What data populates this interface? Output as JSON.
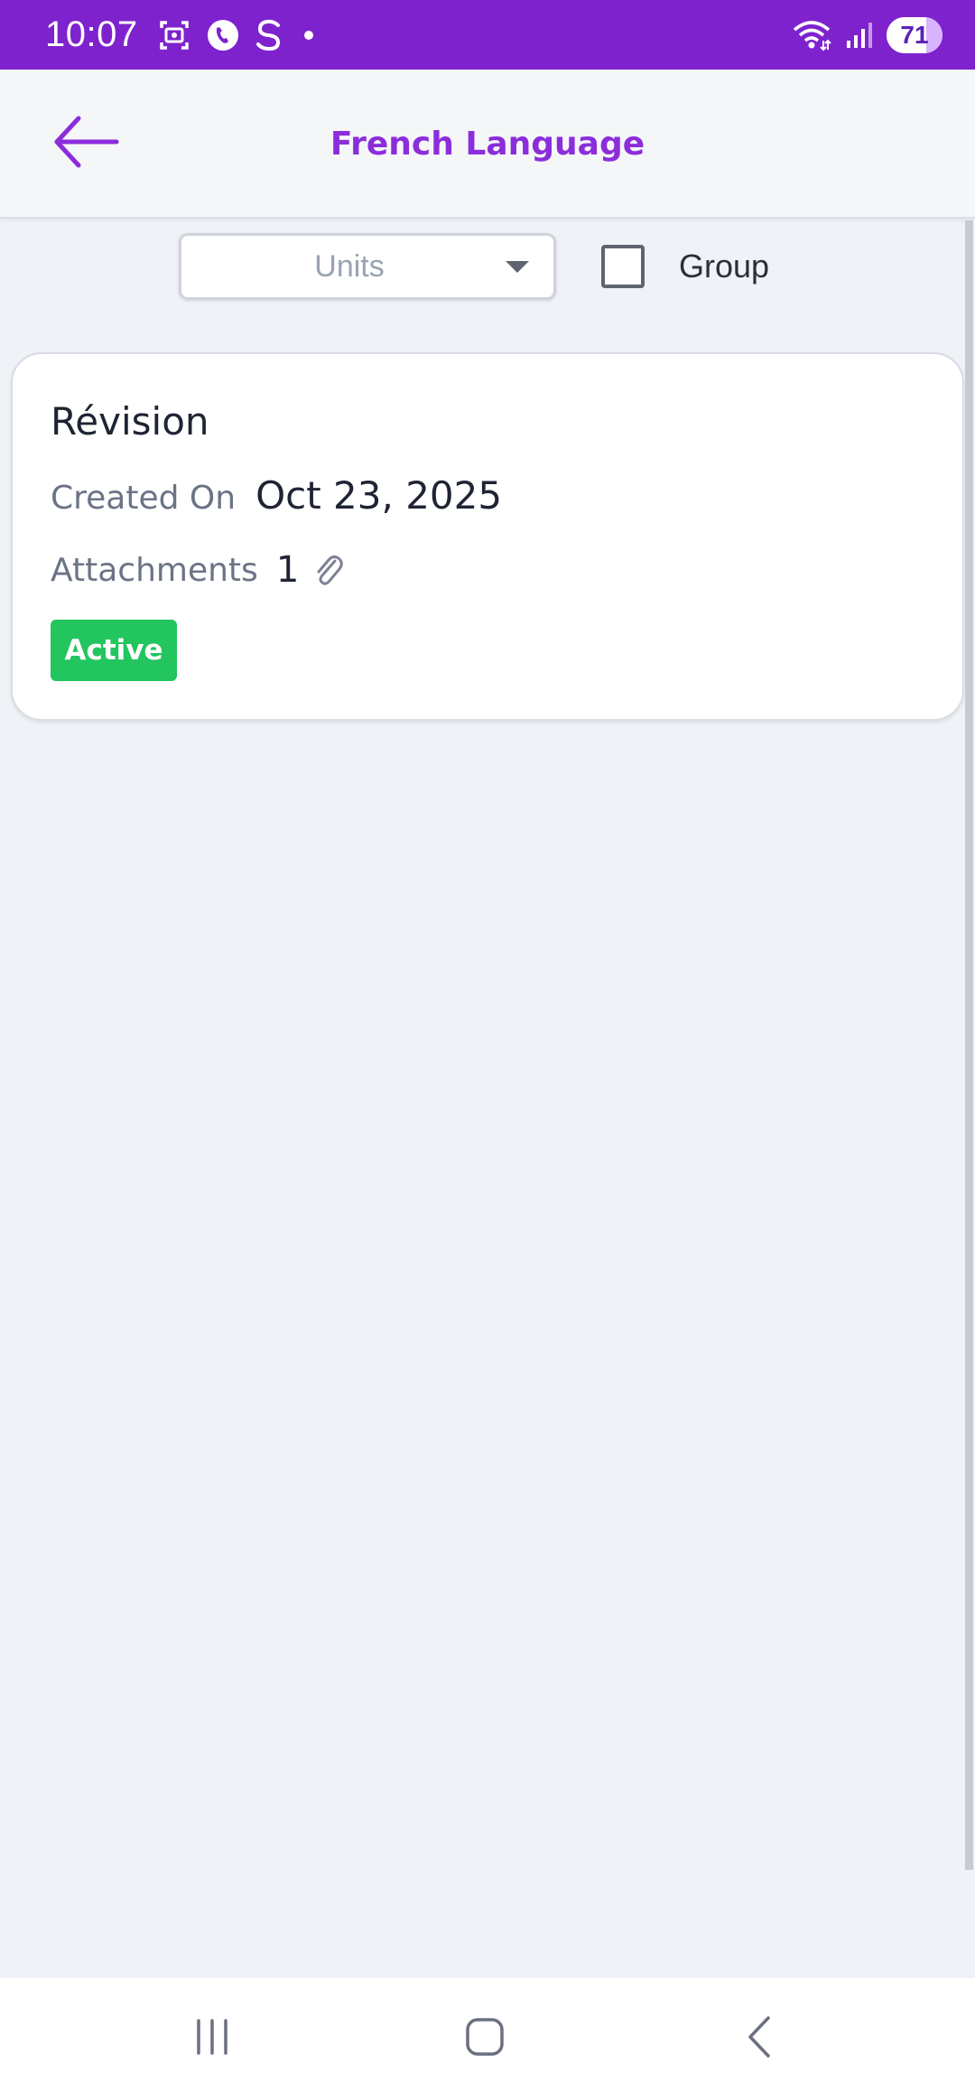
{
  "status_bar": {
    "time": "10:07",
    "battery_level": "71",
    "icons": [
      "screenshot-icon",
      "phone-call-icon",
      "s-app-icon",
      "notification-dot-icon",
      "wifi-icon",
      "signal-icon",
      "battery-icon"
    ]
  },
  "header": {
    "title": "French Language",
    "back_icon": "arrow-left-icon",
    "accent_color": "#8b2ddb",
    "status_bar_color": "#7e22ce"
  },
  "filters": {
    "units_placeholder": "Units",
    "group_label": "Group",
    "group_checked": false
  },
  "card": {
    "title": "Révision",
    "created_label": "Created On",
    "created_value": "Oct 23, 2025",
    "attachments_label": "Attachments",
    "attachments_count": "1",
    "status": "Active",
    "status_color": "#22c55e"
  },
  "nav": {
    "items": [
      "recents-icon",
      "home-icon",
      "back-icon"
    ]
  }
}
